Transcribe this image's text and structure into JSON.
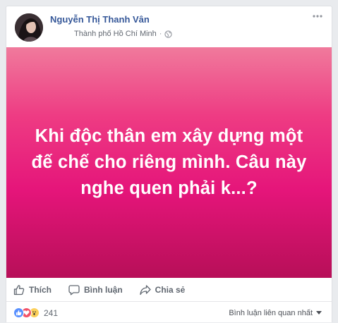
{
  "post": {
    "author_name": "Nguyễn Thị Thanh Vân",
    "location": "Thành phố Hồ Chí Minh",
    "separator": "·",
    "status_text": "Khi độc thân em xây dựng một đế chế cho riêng mình. Câu này nghe quen phải k...?",
    "background_colors": [
      "#f07a9c",
      "#ee3b83",
      "#e5157a",
      "#b70f58"
    ]
  },
  "actions": {
    "like_label": "Thích",
    "comment_label": "Bình luận",
    "share_label": "Chia sẻ"
  },
  "footer": {
    "reaction_icons": [
      "like-icon",
      "love-icon",
      "wow-icon"
    ],
    "reaction_count": "241",
    "sort_label": "Bình luận liên quan nhất"
  },
  "colors": {
    "author_link": "#365899",
    "action_text": "#606770",
    "like_blue": "#5890ff",
    "love_red": "#f25268",
    "wow_yellow": "#fcd05a"
  }
}
